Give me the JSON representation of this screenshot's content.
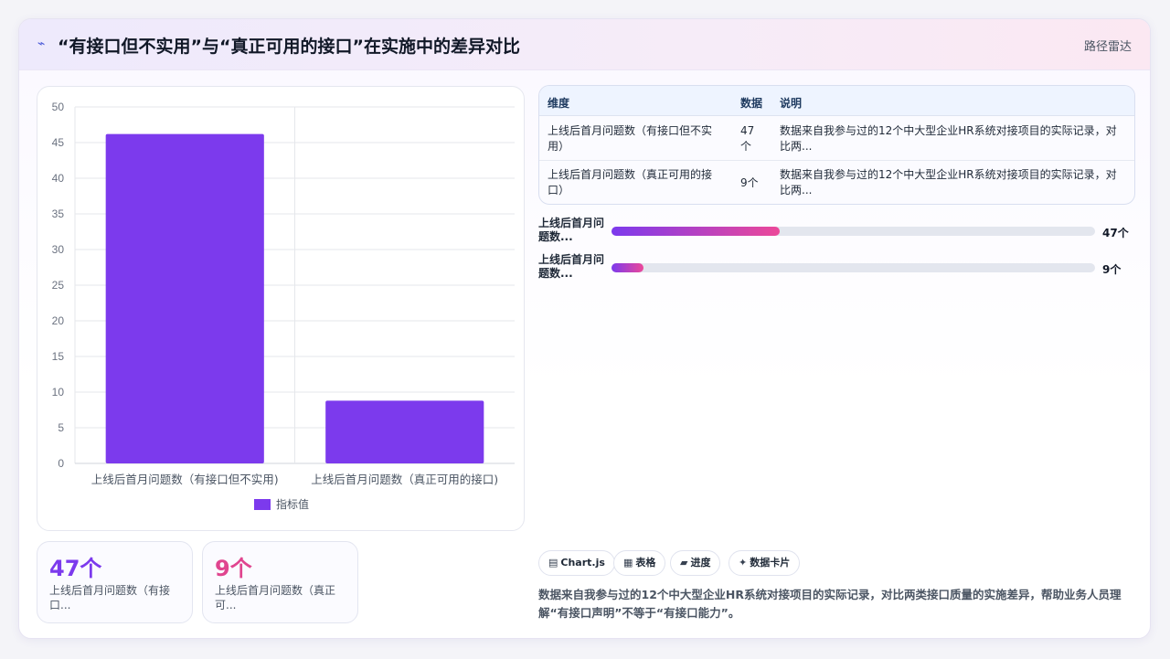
{
  "header": {
    "icon": "⌁",
    "title": "“有接口但不实用”与“真正可用的接口”在实施中的差异对比",
    "tag": "路径雷达"
  },
  "chart_data": {
    "type": "bar",
    "categories": [
      "上线后首月问题数（有接口但不实用)",
      "上线后首月问题数（真正可用的接口)"
    ],
    "series": [
      {
        "name": "指标值",
        "values": [
          46.2,
          8.8
        ]
      }
    ],
    "ylim": [
      0,
      50
    ],
    "yticks": [
      0,
      5,
      10,
      15,
      20,
      25,
      30,
      35,
      40,
      45,
      50
    ],
    "bar_color": "#7c3aed",
    "legend_position": "bottom",
    "grid": true
  },
  "stats": [
    {
      "value": "47个",
      "label": "上线后首月问题数（有接口...",
      "color": "#7c3aed"
    },
    {
      "value": "9个",
      "label": "上线后首月问题数（真正可...",
      "color": "#e0458f"
    }
  ],
  "table": {
    "headers": [
      "维度",
      "数据",
      "说明"
    ],
    "rows": [
      {
        "dim": "上线后首月问题数（有接口但不实用）",
        "val": "47个",
        "note": "数据来自我参与过的12个中大型企业HR系统对接项目的实际记录，对比两..."
      },
      {
        "dim": "上线后首月问题数（真正可用的接口）",
        "val": "9个",
        "note": "数据来自我参与过的12个中大型企业HR系统对接项目的实际记录，对比两..."
      }
    ]
  },
  "progress": [
    {
      "label": "上线后首月问题数...",
      "value": "47个",
      "fraction": 0.347
    },
    {
      "label": "上线后首月问题数...",
      "value": "9个",
      "fraction": 0.066
    }
  ],
  "pills": [
    {
      "icon": "▤",
      "label": "Chart.js"
    },
    {
      "icon": "▦",
      "label": "表格"
    },
    {
      "icon": "▰",
      "label": "进度"
    },
    {
      "icon": "✦",
      "label": "数据卡片"
    }
  ],
  "description": "数据来自我参与过的12个中大型企业HR系统对接项目的实际记录，对比两类接口质量的实施差异，帮助业务人员理解“有接口声明”不等于“有接口能力”。",
  "colors": {
    "accent": "#7c3aed",
    "accent2": "#ec4899"
  }
}
